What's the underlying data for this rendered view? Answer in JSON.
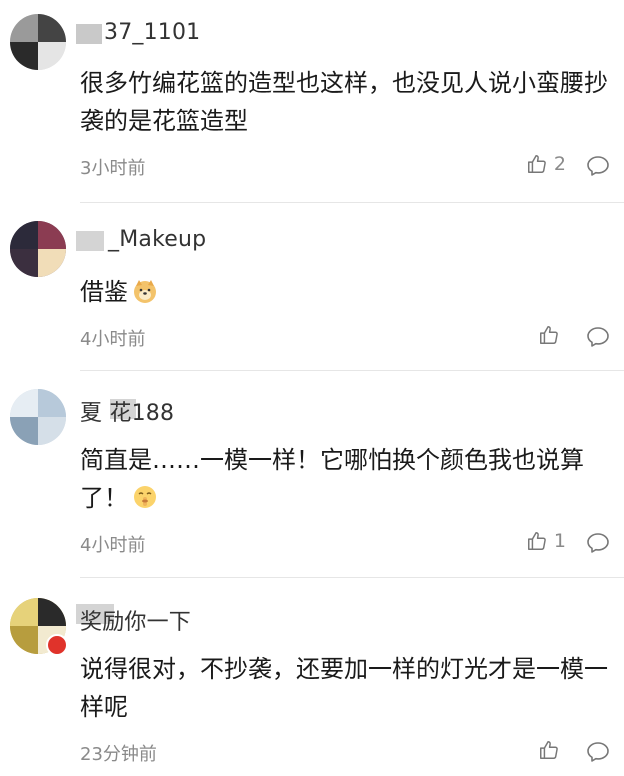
{
  "comments": [
    {
      "username": "37_1101",
      "text": "很多竹编花篮的造型也这样，也没见人说小蛮腰抄袭的是花篮造型",
      "time": "3小时前",
      "likes": "2"
    },
    {
      "username": "_Makeup",
      "text": "借鉴",
      "time": "4小时前",
      "likes": ""
    },
    {
      "username": "夏 花188",
      "text": "简直是……一模一样！它哪怕换个颜色我也说算了！",
      "time": "4小时前",
      "likes": "1"
    },
    {
      "username": "奖励你一下",
      "text": "说得很对，不抄袭，还要加一样的灯光才是一模一样呢",
      "time": "23分钟前",
      "likes": ""
    }
  ]
}
